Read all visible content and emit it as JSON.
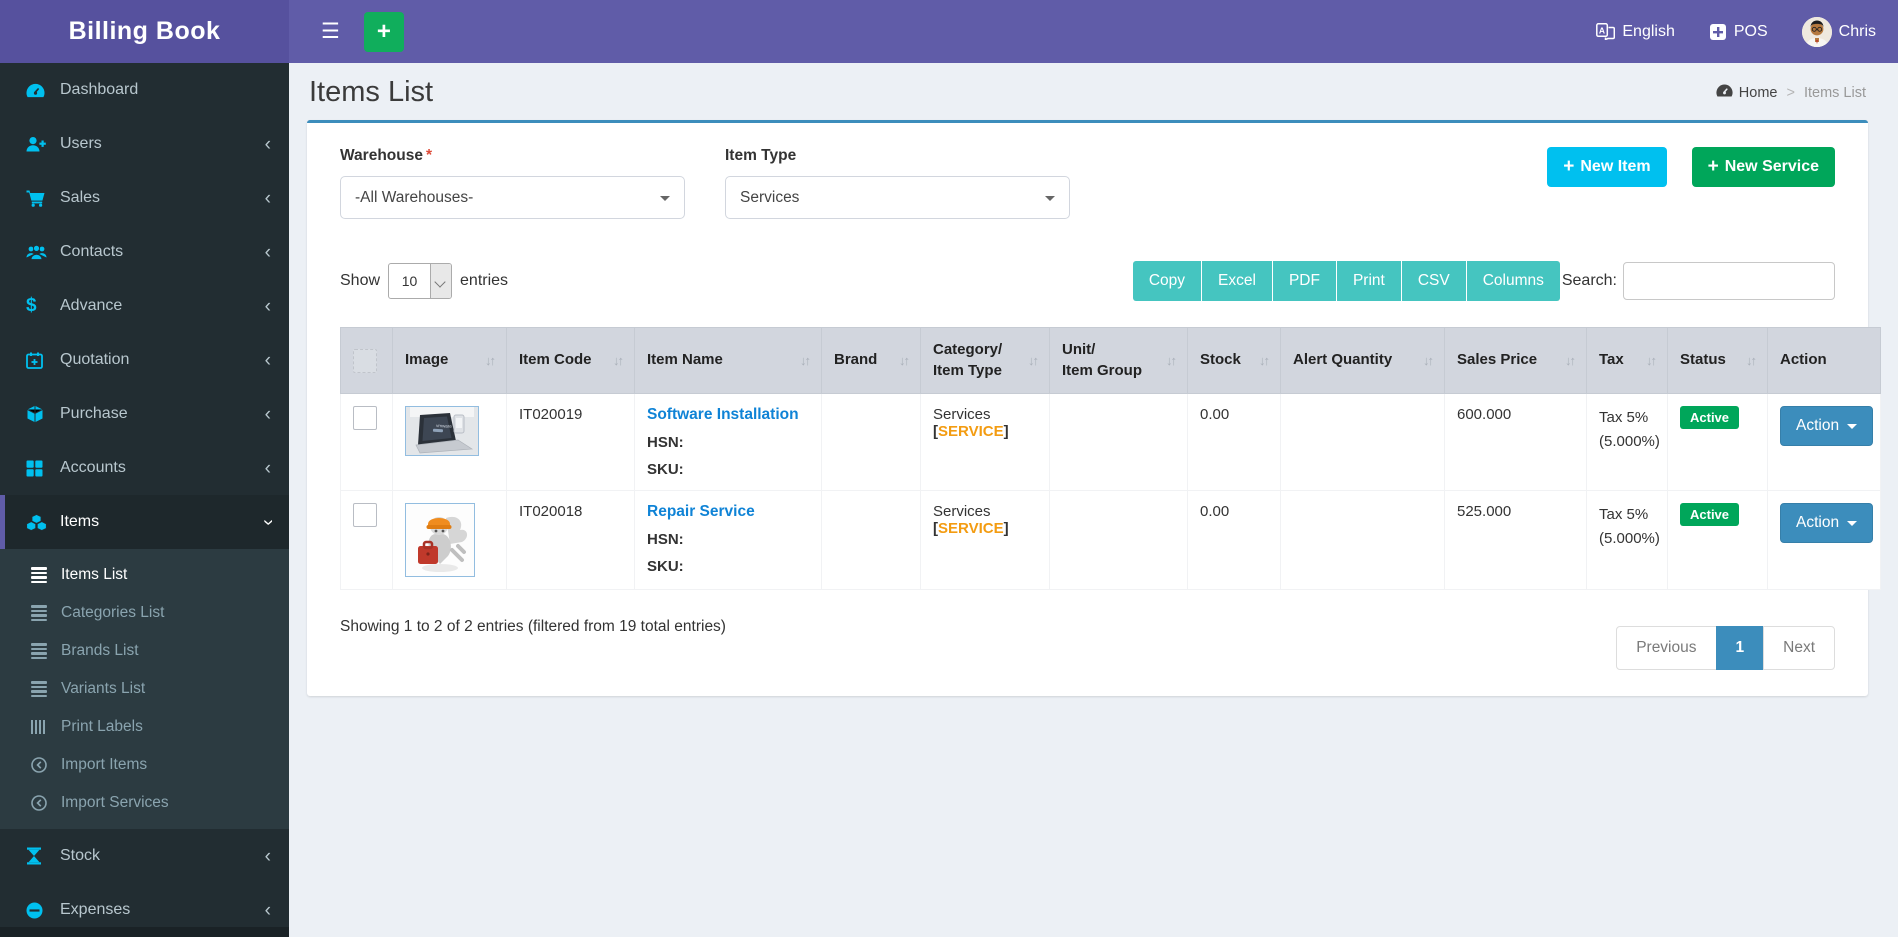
{
  "app": {
    "name": "Billing Book"
  },
  "navbar": {
    "language_label": "English",
    "pos_label": "POS",
    "username": "Chris"
  },
  "icons": {
    "menu": "☰",
    "plus": "+",
    "sort_both": "↓↑",
    "chevron_left": "‹",
    "breadcrumb_separator": ">"
  },
  "sidebar": {
    "items": [
      {
        "label": "Dashboard"
      },
      {
        "label": "Users"
      },
      {
        "label": "Sales"
      },
      {
        "label": "Contacts"
      },
      {
        "label": "Advance"
      },
      {
        "label": "Quotation"
      },
      {
        "label": "Purchase"
      },
      {
        "label": "Accounts"
      },
      {
        "label": "Items"
      },
      {
        "label": "Stock"
      },
      {
        "label": "Expenses"
      }
    ],
    "items_submenu": [
      {
        "label": "Items List"
      },
      {
        "label": "Categories List"
      },
      {
        "label": "Brands List"
      },
      {
        "label": "Variants List"
      },
      {
        "label": "Print Labels"
      },
      {
        "label": "Import Items"
      },
      {
        "label": "Import Services"
      }
    ]
  },
  "page": {
    "title": "Items List",
    "breadcrumb_home": "Home",
    "breadcrumb_current": "Items List"
  },
  "filters": {
    "warehouse_label": "Warehouse",
    "required_mark": "*",
    "warehouse_value": "-All Warehouses-",
    "item_type_label": "Item Type",
    "item_type_value": "Services"
  },
  "actions": {
    "new_item": "New Item",
    "new_service": "New Service"
  },
  "table_controls": {
    "show_label": "Show",
    "page_length": "10",
    "entries_label": "entries",
    "export_buttons": {
      "copy": "Copy",
      "excel": "Excel",
      "pdf": "PDF",
      "print": "Print",
      "csv": "CSV",
      "columns": "Columns"
    },
    "search_label": "Search:"
  },
  "table": {
    "columns": [
      {
        "label": ""
      },
      {
        "label": "Image"
      },
      {
        "label": "Item Code"
      },
      {
        "label": "Item Name"
      },
      {
        "label": "Brand"
      },
      {
        "label": "Category/\nItem Type"
      },
      {
        "label": "Unit/\nItem Group"
      },
      {
        "label": "Stock"
      },
      {
        "label": "Alert Quantity"
      },
      {
        "label": "Sales Price"
      },
      {
        "label": "Tax"
      },
      {
        "label": "Status"
      },
      {
        "label": "Action"
      }
    ],
    "rows": [
      {
        "image": "laptop-photo",
        "item_code": "IT020019",
        "item_name": "Software Installation",
        "brand": "",
        "category": "Services",
        "category_tag": "SERVICE",
        "unit_item_group": "",
        "stock": "0.00",
        "alert_quantity": "",
        "sales_price": "600.000",
        "tax": "Tax 5%\n(5.000%)",
        "status": "Active",
        "action_label": "Action"
      },
      {
        "image": "repair-figure",
        "item_code": "IT020018",
        "item_name": "Repair Service",
        "brand": "",
        "category": "Services",
        "category_tag": "SERVICE",
        "unit_item_group": "",
        "stock": "0.00",
        "alert_quantity": "",
        "sales_price": "525.000",
        "tax": "Tax 5%\n(5.000%)",
        "status": "Active",
        "action_label": "Action"
      }
    ]
  },
  "labels": {
    "hsn": "HSN:",
    "sku": "SKU:",
    "bracket_open": "[",
    "bracket_close": "]"
  },
  "footer": {
    "info": "Showing 1 to 2 of 2 entries (filtered from 19 total entries)"
  },
  "pagination": {
    "previous": "Previous",
    "current_page": "1",
    "next": "Next"
  },
  "colors": {
    "navbar_purple": "#605ca8",
    "logo_purple": "#56519e",
    "sidebar_dark": "#222d32",
    "submenu_dark": "#2c3b41",
    "icon_accent": "#00c0ef",
    "primary_blue": "#3c8dbc",
    "success_green": "#00a65a",
    "info_cyan": "#00c0ef",
    "export_teal": "#45c5c0",
    "link_blue": "#0f83d6",
    "tag_orange": "#f39c12",
    "table_header_bg": "#d2d6de",
    "content_bg": "#ecf0f5"
  }
}
